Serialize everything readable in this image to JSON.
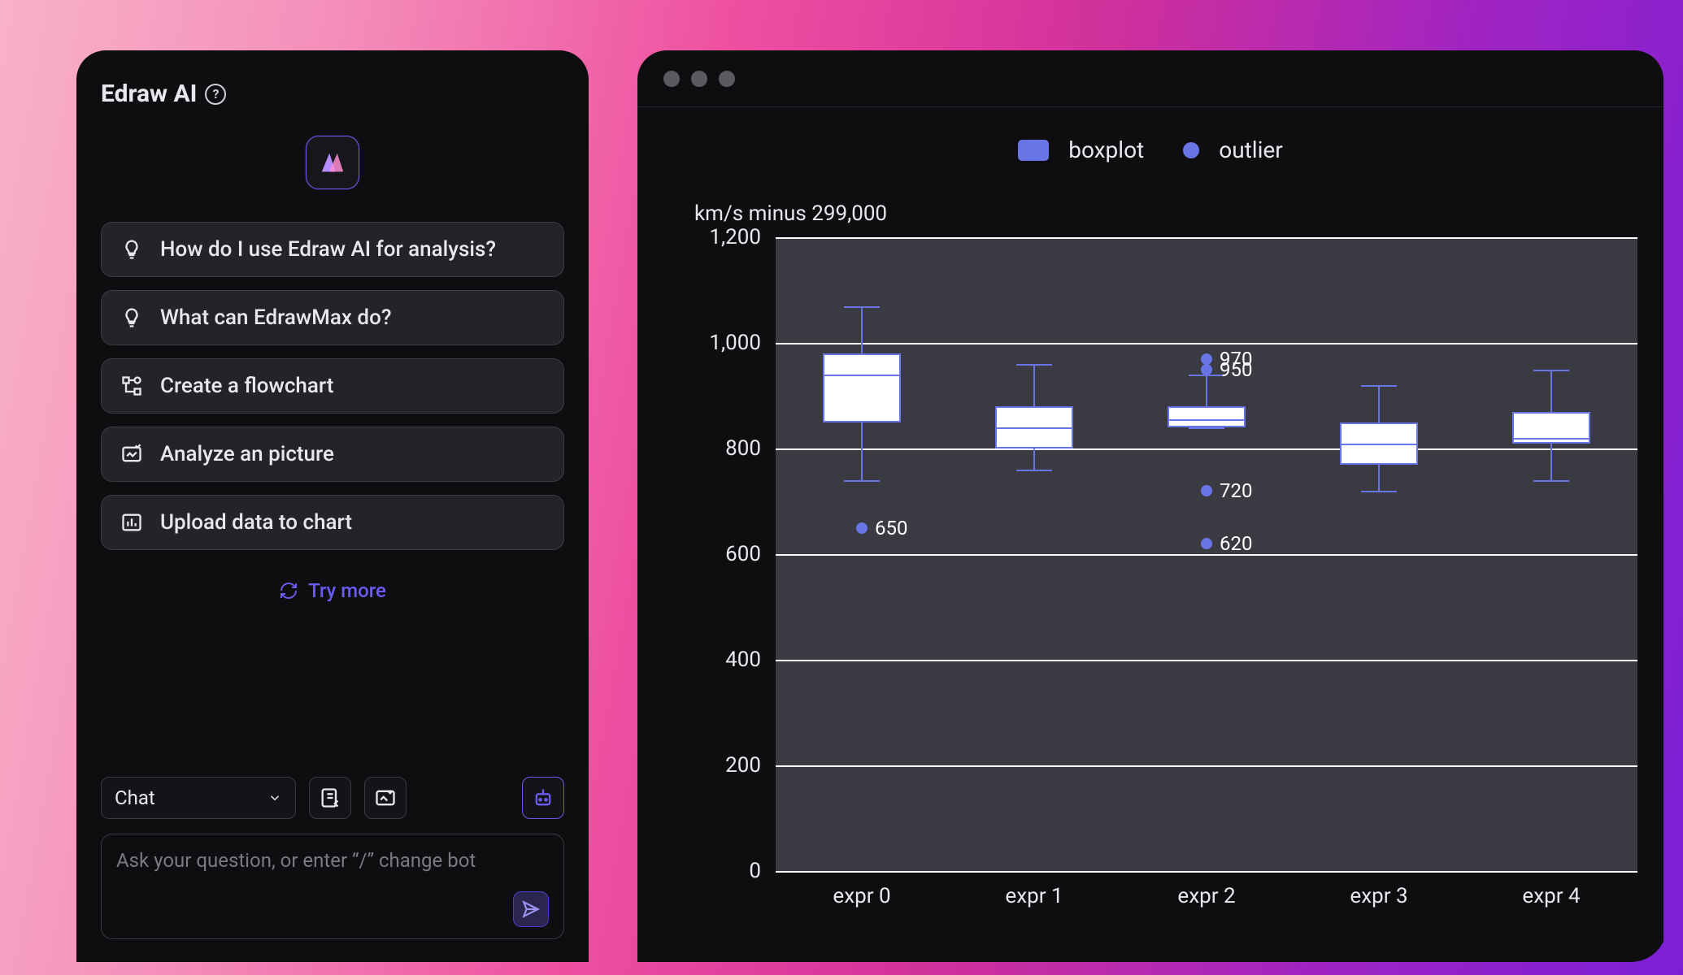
{
  "sidebar": {
    "title": "Edraw AI",
    "suggestions": [
      {
        "icon": "lightbulb-icon",
        "label": "How do I use Edraw AI for analysis?"
      },
      {
        "icon": "lightbulb-icon",
        "label": "What can EdrawMax do?"
      },
      {
        "icon": "flowchart-icon",
        "label": "Create a flowchart"
      },
      {
        "icon": "picture-check-icon",
        "label": "Analyze an picture"
      },
      {
        "icon": "chart-upload-icon",
        "label": "Upload data to chart"
      }
    ],
    "try_more": "Try more",
    "mode_selected": "Chat",
    "chat_placeholder": "Ask your question, or enter “/” change bot"
  },
  "legend": {
    "boxplot": "boxplot",
    "outlier": "outlier"
  },
  "chart_data": {
    "type": "boxplot",
    "title": "km/s minus 299,000",
    "ylabel": "km/s minus 299,000",
    "ylim": [
      0,
      1200
    ],
    "yticks": [
      0,
      200,
      400,
      600,
      800,
      1000,
      1200
    ],
    "categories": [
      "expr 0",
      "expr 1",
      "expr 2",
      "expr 3",
      "expr 4"
    ],
    "series": [
      {
        "name": "expr 0",
        "min": 740,
        "q1": 850,
        "median": 940,
        "q3": 980,
        "max": 1070,
        "outliers": [
          650
        ]
      },
      {
        "name": "expr 1",
        "min": 760,
        "q1": 800,
        "median": 840,
        "q3": 880,
        "max": 960,
        "outliers": []
      },
      {
        "name": "expr 2",
        "min": 840,
        "q1": 840,
        "median": 855,
        "q3": 880,
        "max": 940,
        "outliers": [
          970,
          950,
          720,
          620
        ]
      },
      {
        "name": "expr 3",
        "min": 720,
        "q1": 770,
        "median": 810,
        "q3": 850,
        "max": 920,
        "outliers": []
      },
      {
        "name": "expr 4",
        "min": 740,
        "q1": 810,
        "median": 820,
        "q3": 870,
        "max": 950,
        "outliers": []
      }
    ],
    "visible_outlier_labels": [
      {
        "series": 0,
        "value": 650
      },
      {
        "series": 2,
        "value": 970
      },
      {
        "series": 2,
        "value": 950
      },
      {
        "series": 2,
        "value": 720
      },
      {
        "series": 2,
        "value": 620
      }
    ]
  },
  "colors": {
    "accent": "#6a5cf0",
    "plot_series": "#6a75e5",
    "panel_bg": "#0e0e11"
  }
}
